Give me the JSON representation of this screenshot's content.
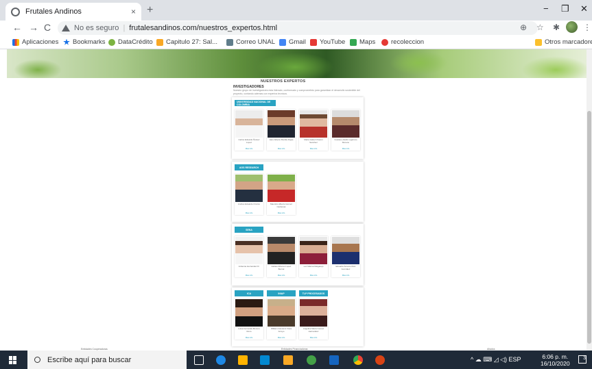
{
  "browser": {
    "tab_title": "Frutales Andinos",
    "tab_close": "×",
    "new_tab": "+",
    "win_minimize": "−",
    "win_restore": "❐",
    "win_close": "✕",
    "nav_back": "←",
    "nav_forward": "→",
    "nav_reload": "C",
    "security_label": "No es seguro",
    "separator": "|",
    "url": "frutalesandinos.com/nuestros_expertos.html",
    "bookmarks": [
      "Aplicaciones",
      "Bookmarks",
      "DataCrédito",
      "Capitulo 27: Sal...",
      "Correo UNAL",
      "Gmail",
      "YouTube",
      "Maps",
      "recoleccion"
    ],
    "other_bookmarks": "Otros marcadores"
  },
  "page": {
    "title": "NUESTROS EXPERTOS",
    "section": "INVESTIGADORES",
    "description": "Nuestro grupo de investigadores esta liderado, conformado y comprometido para garantizar el desarrollo sostenible del proyecto, contando ademas con expertos tecnicos.",
    "link_label": "Mas info",
    "groups": [
      {
        "institutions": [
          "UNIVERSIDAD NACIONAL DE COLOMBIA"
        ],
        "people": [
          {
            "name": "Carlos Eduardo Ñustez Lopez"
          },
          {
            "name": "Jairo Alberto Bonilla Rojas"
          },
          {
            "name": "Maria Isabel Chacon Sanchez"
          },
          {
            "name": "Gustavo Adolfo Ligarreto Moreno"
          }
        ]
      },
      {
        "institutions": [
          "AGS RESEARCH"
        ],
        "people": [
          {
            "name": "Andres Eduardo Orozco"
          },
          {
            "name": "Mauricio Alberto Gomez Cardenas"
          }
        ]
      },
      {
        "institutions": [
          "SENA"
        ],
        "people": [
          {
            "name": "Johanna Hernandez R."
          },
          {
            "name": "Fabian Alfonso Lopez Bernal"
          },
          {
            "name": "Luz Marina Melgarejo"
          },
          {
            "name": "Eduardo Antonio Ruiz Gonzalez"
          }
        ]
      },
      {
        "institutions": [
          "ICA",
          "INIAP",
          "TLP PROCESADOS"
        ],
        "people": [
          {
            "name": "Luisa Fernanda Moreno Rozo"
          },
          {
            "name": "William Giovanni Viera Arroyo"
          },
          {
            "name": "Angelica Maria Gomez Hernandez"
          }
        ]
      }
    ],
    "footer": [
      "Entidades Cooperadoras",
      "Entidades Financiadoras",
      "Aliados"
    ]
  },
  "taskbar": {
    "search_placeholder": "Escribe aquí para buscar",
    "tray_text": "^  ☁  ⌨  ◿  ◁)  ESP",
    "time": "6:06 p. m.",
    "date": "16/10/2020",
    "notifications": "3"
  }
}
